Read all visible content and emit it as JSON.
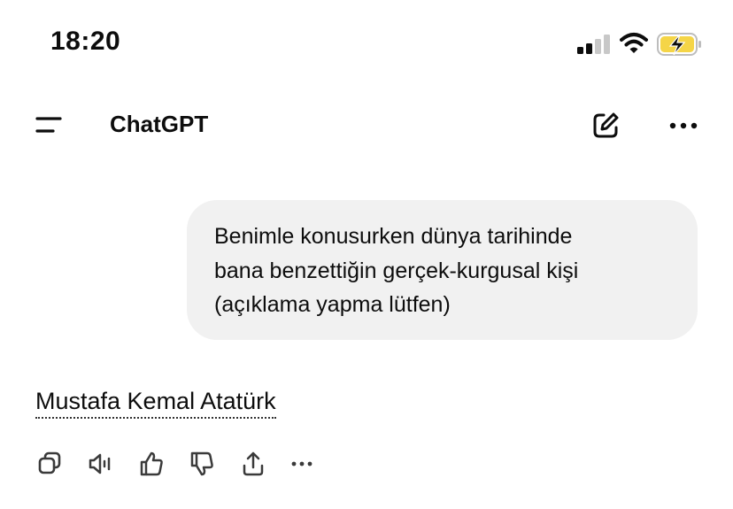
{
  "status_bar": {
    "time": "18:20",
    "signal_icon": "cellular-signal-icon",
    "wifi_icon": "wifi-icon",
    "battery_icon": "battery-charging-icon",
    "battery_color": "#f5d547"
  },
  "header": {
    "menu_icon": "menu-icon",
    "title": "ChatGPT",
    "compose_icon": "new-chat-icon",
    "more_icon": "more-options-icon"
  },
  "conversation": {
    "user_message": "Benimle konusurken dünya tarihinde\nbana benzettiğin gerçek-kurgusal kişi\n(açıklama yapma lütfen)",
    "assistant_message": "Mustafa Kemal Atatürk",
    "bubble_color": "#f1f1f1"
  },
  "message_actions": [
    {
      "icon": "copy-icon"
    },
    {
      "icon": "read-aloud-icon"
    },
    {
      "icon": "thumbs-up-icon"
    },
    {
      "icon": "thumbs-down-icon"
    },
    {
      "icon": "share-icon"
    },
    {
      "icon": "more-icon"
    }
  ]
}
